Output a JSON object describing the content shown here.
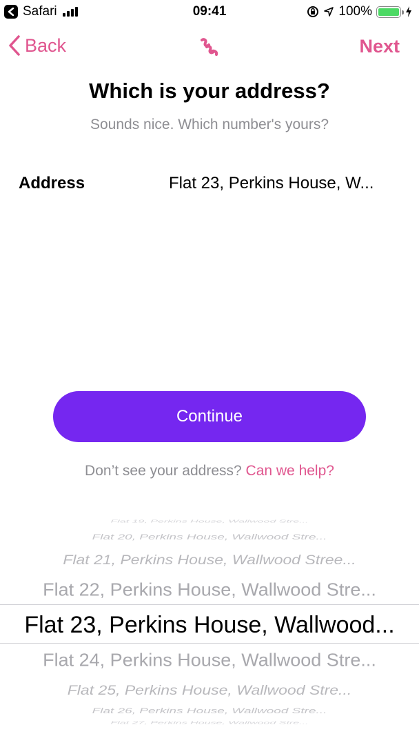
{
  "status_bar": {
    "app": "Safari",
    "time": "09:41",
    "battery": "100%",
    "battery_level": 1.0
  },
  "nav": {
    "back_label": "Back",
    "next_label": "Next",
    "accent_color": "#e0568f"
  },
  "title": "Which is your address?",
  "subtitle": "Sounds nice. Which number's yours?",
  "address": {
    "label": "Address",
    "value": "Flat 23, Perkins House, W..."
  },
  "continue_label": "Continue",
  "continue_color": "#7527f0",
  "help": {
    "prefix": "Don’t see your address?",
    "link": "Can we help?"
  },
  "picker": {
    "selected_index": 4,
    "items": [
      "Flat 19, Perkins House, Wallwood Stre...",
      "Flat 20, Perkins House, Wallwood Stre...",
      "Flat 21, Perkins House, Wallwood Stree...",
      "Flat 22, Perkins House, Wallwood Stre...",
      "Flat 23, Perkins House, Wallwood...",
      "Flat 24, Perkins House, Wallwood Stre...",
      "Flat 25, Perkins House, Wallwood Stre...",
      "Flat 26, Perkins House, Wallwood Stre...",
      "Flat 27, Perkins House, Wallwood Stre..."
    ]
  }
}
